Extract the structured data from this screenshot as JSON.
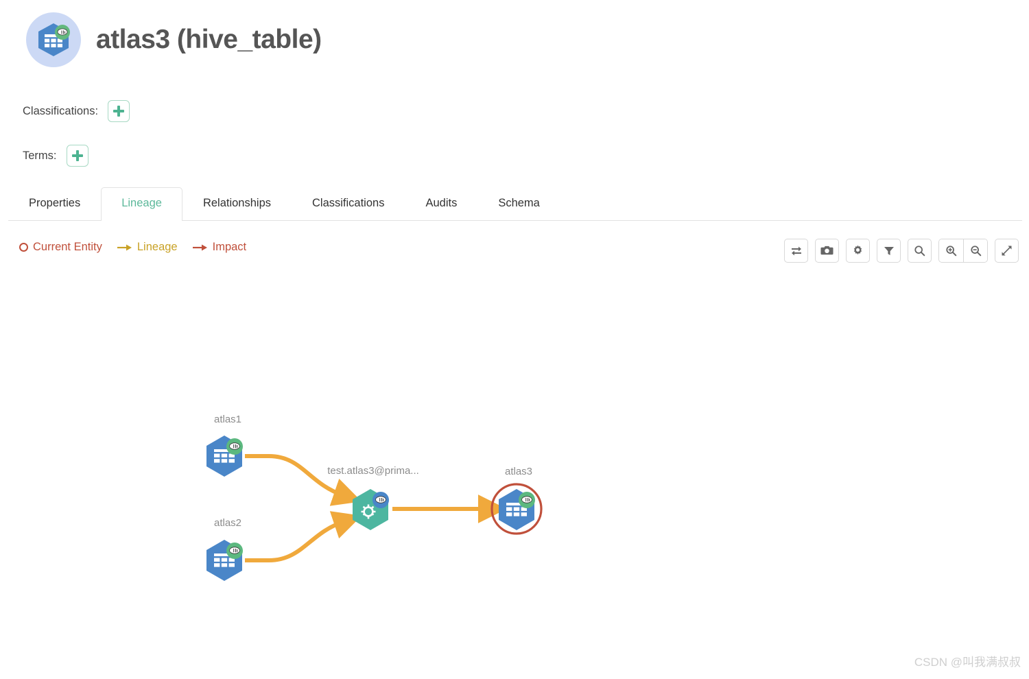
{
  "header": {
    "title": "atlas3 (hive_table)",
    "icon_name": "hive-table-icon"
  },
  "meta": {
    "classifications_label": "Classifications:",
    "terms_label": "Terms:",
    "add_icon": "plus-icon"
  },
  "tabs": [
    {
      "label": "Properties",
      "active": false
    },
    {
      "label": "Lineage",
      "active": true
    },
    {
      "label": "Relationships",
      "active": false
    },
    {
      "label": "Classifications",
      "active": false
    },
    {
      "label": "Audits",
      "active": false
    },
    {
      "label": "Schema",
      "active": false
    }
  ],
  "legend": [
    {
      "label": "Current Entity",
      "marker": "circle-outline",
      "color": "#c0503b"
    },
    {
      "label": "Lineage",
      "marker": "arrow",
      "color": "#c9a227"
    },
    {
      "label": "Impact",
      "marker": "arrow",
      "color": "#c0503b"
    }
  ],
  "toolbar": [
    {
      "name": "swap-lineage-button",
      "icon": "swap-arrows-icon"
    },
    {
      "name": "screenshot-button",
      "icon": "camera-icon"
    },
    {
      "name": "settings-button",
      "icon": "gear-icon"
    },
    {
      "name": "filter-button",
      "icon": "filter-funnel-icon"
    },
    {
      "name": "search-button",
      "icon": "search-icon"
    },
    {
      "name": "zoom-in-button",
      "icon": "zoom-in-icon"
    },
    {
      "name": "zoom-out-button",
      "icon": "zoom-out-icon"
    },
    {
      "name": "fullscreen-button",
      "icon": "expand-arrows-icon"
    }
  ],
  "lineage": {
    "nodes": [
      {
        "id": "atlas1",
        "label": "atlas1",
        "type": "hive_table",
        "shape": "hexagon",
        "color": "#4a86c8",
        "badge": "hive-badge-green",
        "current": false
      },
      {
        "id": "atlas2",
        "label": "atlas2",
        "type": "hive_table",
        "shape": "hexagon",
        "color": "#4a86c8",
        "badge": "hive-badge-green",
        "current": false
      },
      {
        "id": "process",
        "label": "test.atlas3@prima...",
        "type": "hive_process",
        "shape": "hexagon",
        "color": "#4db6a0",
        "badge": "hive-badge-blue",
        "current": false
      },
      {
        "id": "atlas3",
        "label": "atlas3",
        "type": "hive_table",
        "shape": "hexagon",
        "color": "#4a86c8",
        "badge": "hive-badge-green",
        "current": true
      }
    ],
    "edges": [
      {
        "from": "atlas1",
        "to": "process",
        "color": "#f0a93c"
      },
      {
        "from": "atlas2",
        "to": "process",
        "color": "#f0a93c"
      },
      {
        "from": "process",
        "to": "atlas3",
        "color": "#f0a93c"
      }
    ],
    "current_entity_outline_color": "#c0503b"
  },
  "watermark": "CSDN @叫我满叔叔"
}
